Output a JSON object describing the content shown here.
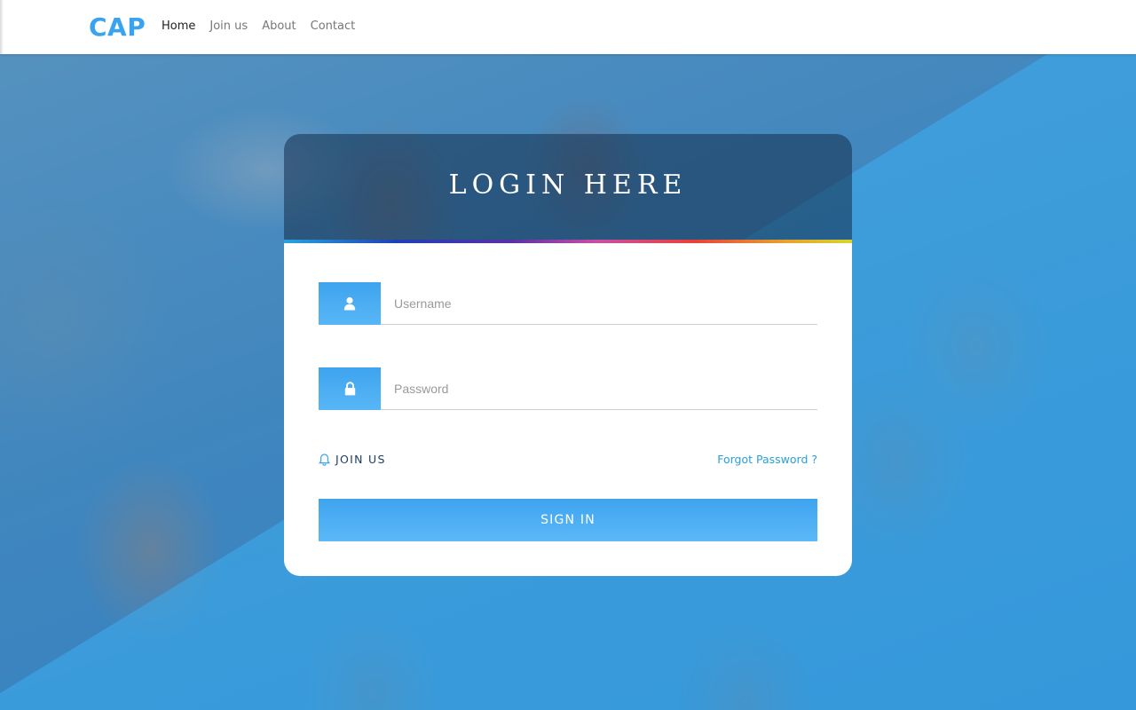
{
  "brand": {
    "name": "CAP"
  },
  "nav": {
    "items": [
      {
        "label": "Home",
        "active": true
      },
      {
        "label": "Join us",
        "active": false
      },
      {
        "label": "About",
        "active": false
      },
      {
        "label": "Contact",
        "active": false
      }
    ]
  },
  "login": {
    "title": "LOGIN HERE",
    "username": {
      "placeholder": "Username",
      "value": "",
      "icon": "user-icon"
    },
    "password": {
      "placeholder": "Password",
      "value": "",
      "icon": "lock-icon"
    },
    "join_label": "JOIN US",
    "join_icon": "bell-icon",
    "forgot_label": "Forgot Password ?",
    "signin_label": "SIGN IN"
  },
  "colors": {
    "accent": "#3aa3f0",
    "button": "#4aaef3",
    "card_header": "#142d4b",
    "join_text": "#1d3f66",
    "link": "#2a9fd8"
  }
}
